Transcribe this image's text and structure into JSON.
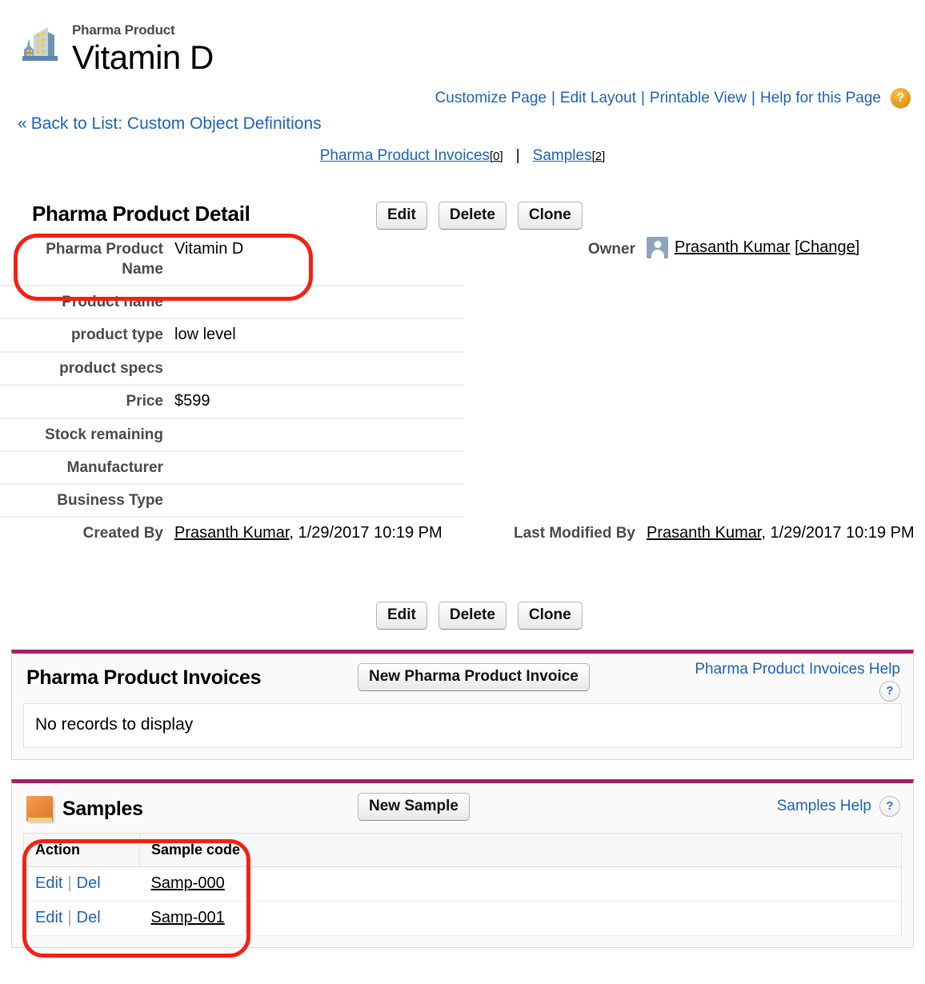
{
  "header": {
    "object_label": "Pharma Product",
    "record_name": "Vitamin D",
    "icon": "building-icon"
  },
  "top_links": {
    "items": [
      {
        "label": "Customize Page"
      },
      {
        "label": "Edit Layout"
      },
      {
        "label": "Printable View"
      },
      {
        "label": "Help for this Page"
      }
    ],
    "separator": "|",
    "help_orb": "?"
  },
  "back_link": {
    "chevron": "«",
    "label": "Back to List: Custom Object Definitions"
  },
  "related_nav": {
    "items": [
      {
        "label": "Pharma Product Invoices",
        "count": "[0]"
      },
      {
        "label": "Samples",
        "count": "[2]"
      }
    ],
    "separator": "|"
  },
  "detail": {
    "title": "Pharma Product Detail",
    "buttons": [
      {
        "label": "Edit"
      },
      {
        "label": "Delete"
      },
      {
        "label": "Clone"
      }
    ],
    "rows": [
      {
        "left": {
          "label": "Pharma Product Name",
          "value": "Vitamin D"
        },
        "right": {
          "label": "Owner",
          "value": "Prasanth Kumar",
          "change_label": "[Change]",
          "avatar": "user-avatar-icon"
        }
      },
      {
        "left": {
          "label": "Product name",
          "value": ""
        },
        "right": {
          "label": "",
          "value": ""
        }
      },
      {
        "left": {
          "label": "product type",
          "value": "low level"
        },
        "right": {
          "label": "",
          "value": ""
        }
      },
      {
        "left": {
          "label": "product specs",
          "value": ""
        },
        "right": {
          "label": "",
          "value": ""
        }
      },
      {
        "left": {
          "label": "Price",
          "value": "$599"
        },
        "right": {
          "label": "",
          "value": ""
        }
      },
      {
        "left": {
          "label": "Stock remaining",
          "value": ""
        },
        "right": {
          "label": "",
          "value": ""
        }
      },
      {
        "left": {
          "label": "Manufacturer",
          "value": ""
        },
        "right": {
          "label": "",
          "value": ""
        }
      },
      {
        "left": {
          "label": "Business Type",
          "value": ""
        },
        "right": {
          "label": "",
          "value": ""
        }
      }
    ],
    "audit": {
      "created": {
        "label": "Created By",
        "user": "Prasanth Kumar",
        "rest": ", 1/29/2017 10:19 PM"
      },
      "modified": {
        "label": "Last Modified By",
        "user": "Prasanth Kumar",
        "rest": ", 1/29/2017 10:19 PM"
      }
    },
    "bottom_buttons": [
      {
        "label": "Edit"
      },
      {
        "label": "Delete"
      },
      {
        "label": "Clone"
      }
    ]
  },
  "invoices_list": {
    "title": "Pharma Product Invoices",
    "new_button": "New Pharma Product Invoice",
    "help_link": "Pharma Product Invoices Help",
    "help_icon": "?",
    "empty_message": "No records to display"
  },
  "samples_list": {
    "title": "Samples",
    "icon": "folder-icon",
    "new_button": "New Sample",
    "help_link": "Samples Help",
    "help_icon": "?",
    "columns": [
      "Action",
      "Sample code"
    ],
    "rows": [
      {
        "edit": "Edit",
        "pipe": "|",
        "del": "Del",
        "code": "Samp-000"
      },
      {
        "edit": "Edit",
        "pipe": "|",
        "del": "Del",
        "code": "Samp-001"
      }
    ]
  },
  "colors": {
    "link": "#1b63b3",
    "related_list_accent": "#a4216b",
    "annotation": "#f42113",
    "label_gray": "#4a4a4a"
  }
}
